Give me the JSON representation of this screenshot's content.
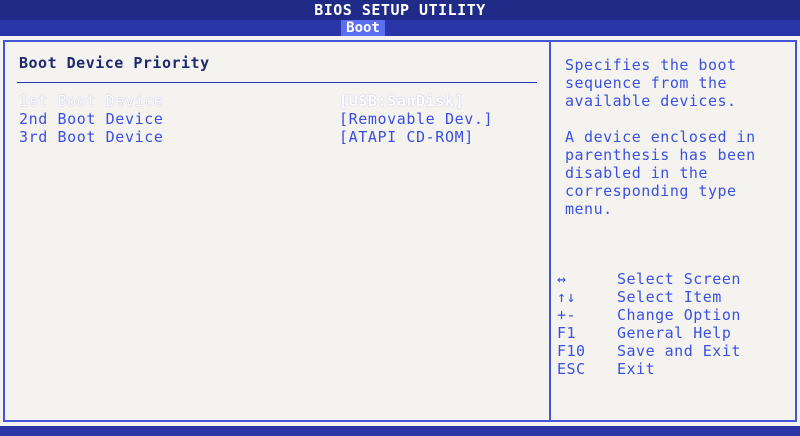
{
  "header": {
    "title": "BIOS SETUP UTILITY",
    "active_tab": "Boot"
  },
  "main": {
    "section_title": "Boot Device Priority",
    "boot_devices": [
      {
        "label": "1st Boot Device",
        "value": "[USB:SanDisk]"
      },
      {
        "label": "2nd Boot Device",
        "value": "[Removable Dev.]"
      },
      {
        "label": "3rd Boot Device",
        "value": "[ATAPI CD-ROM]"
      }
    ]
  },
  "help": {
    "description": "Specifies the boot\nsequence from the\navailable devices.",
    "note": "A device enclosed in\nparenthesis has been\ndisabled in the\ncorresponding type\nmenu.",
    "keys": [
      {
        "key": "↔",
        "desc": "Select Screen"
      },
      {
        "key": "↑↓",
        "desc": "Select Item"
      },
      {
        "key": "+-",
        "desc": "Change Option"
      },
      {
        "key": "F1",
        "desc": "General Help"
      },
      {
        "key": "F10",
        "desc": "Save and Exit"
      },
      {
        "key": "ESC",
        "desc": "Exit"
      }
    ]
  },
  "colors": {
    "title_bar": "#1f2b86",
    "tab_active": "#5c6ff0",
    "text_blue": "#3c4fe0",
    "border": "#4455d6",
    "background": "#f4f3f0"
  }
}
